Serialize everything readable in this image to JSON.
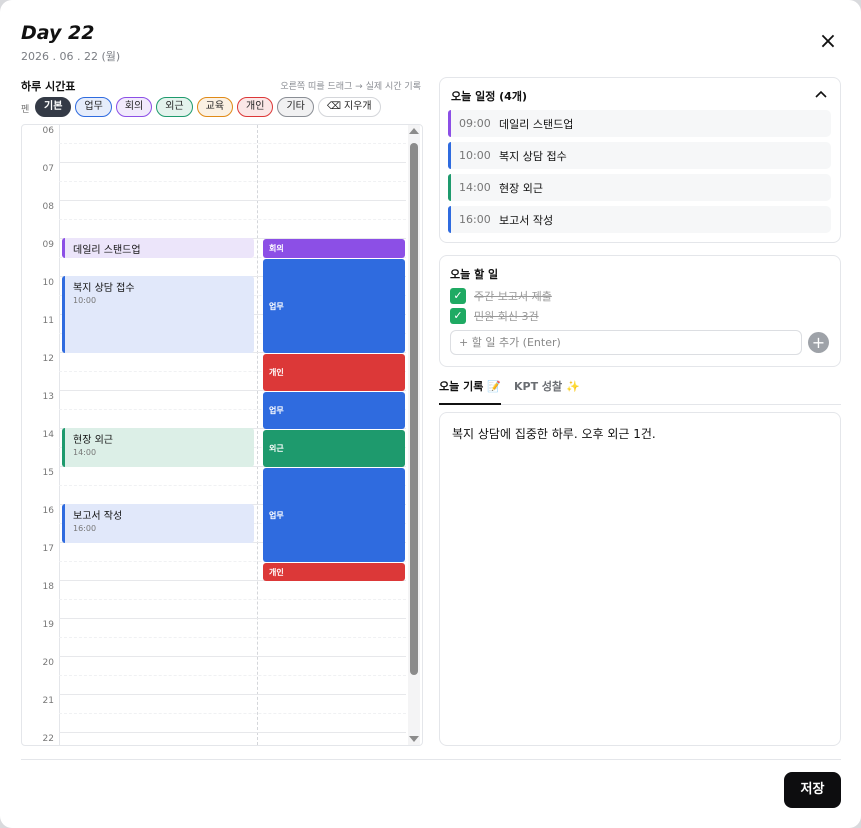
{
  "header": {
    "title": "Day 22",
    "date": "2026 . 06 . 22 (월)",
    "close_icon": "×"
  },
  "timetable": {
    "title": "하루 시간표",
    "hint": "오른쪽 띠를 드래그 → 실제 시간 기록",
    "pen_label": "펜",
    "chips": [
      {
        "label": "기본",
        "color": "#343a46",
        "active": true
      },
      {
        "label": "업무",
        "color": "#2f6bdf"
      },
      {
        "label": "회의",
        "color": "#8c4fe6"
      },
      {
        "label": "외근",
        "color": "#1e9a6d"
      },
      {
        "label": "교육",
        "color": "#e08a17"
      },
      {
        "label": "개인",
        "color": "#dc3838"
      },
      {
        "label": "기타",
        "color": "#8a8e95"
      }
    ],
    "eraser_label": "지우개",
    "eraser_icon": "⌫",
    "hours": [
      "06",
      "07",
      "08",
      "09",
      "10",
      "11",
      "12",
      "13",
      "14",
      "15",
      "16",
      "17",
      "18",
      "19",
      "20",
      "21",
      "22"
    ],
    "planned": [
      {
        "title": "데일리 스탠드업",
        "sub": "09:00",
        "color": "#8c4fe6",
        "bg": "#ece5fa"
      },
      {
        "title": "복지 상담 접수",
        "sub": "10:00",
        "color": "#2f6bdf",
        "bg": "#e1e8fa"
      },
      {
        "title": "현장 외근",
        "sub": "14:00",
        "color": "#1e9a6d",
        "bg": "#dcefe7"
      },
      {
        "title": "보고서 작성",
        "sub": "16:00",
        "color": "#2f6bdf",
        "bg": "#e1e8fa"
      }
    ],
    "actual": [
      {
        "label": "회의",
        "color": "#8c4fe6"
      },
      {
        "label": "업무",
        "color": "#2f6bdf"
      },
      {
        "label": "개인",
        "color": "#dc3838"
      },
      {
        "label": "업무",
        "color": "#2f6bdf"
      },
      {
        "label": "외근",
        "color": "#1e9a6d"
      },
      {
        "label": "업무",
        "color": "#2f6bdf"
      },
      {
        "label": "개인",
        "color": "#dc3838"
      }
    ]
  },
  "schedule": {
    "title": "오늘 일정 (4개)",
    "collapse_icon": "chevron-up",
    "items": [
      {
        "time": "09:00",
        "name": "데일리 스탠드업",
        "color": "#8c4fe6"
      },
      {
        "time": "10:00",
        "name": "복지 상담 접수",
        "color": "#2f6bdf"
      },
      {
        "time": "14:00",
        "name": "현장 외근",
        "color": "#1e9a6d"
      },
      {
        "time": "16:00",
        "name": "보고서 작성",
        "color": "#2f6bdf"
      }
    ]
  },
  "todos": {
    "title": "오늘 할 일",
    "items": [
      {
        "text": "주간 보고서 제출",
        "done": true
      },
      {
        "text": "민원 회신 3건",
        "done": true
      }
    ],
    "input_placeholder": "+ 할 일 추가 (Enter)",
    "add_icon": "+"
  },
  "tabs": {
    "record": "오늘 기록 📝",
    "kpt": "KPT 성찰 ✨"
  },
  "notes": {
    "text": "복지 상담에 집중한 하루. 오후 외근 1건."
  },
  "footer": {
    "save_label": "저장"
  }
}
